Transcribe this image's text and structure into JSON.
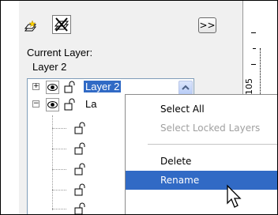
{
  "panel": {
    "current_layer_label": "Current Layer:",
    "current_layer_value": "Layer 2",
    "expand_button": ">>"
  },
  "tree": {
    "rows": [
      {
        "expander": "+",
        "label": "Layer 2",
        "selected": true
      },
      {
        "expander": "−",
        "label": "La",
        "selected": false
      }
    ]
  },
  "ruler": {
    "number": "105"
  },
  "context_menu": {
    "items": [
      {
        "label": "Select All",
        "enabled": true
      },
      {
        "label": "Select Locked Layers",
        "enabled": false
      },
      {
        "label": "Delete",
        "enabled": true
      },
      {
        "label": "Rename",
        "enabled": true,
        "highlighted": true
      }
    ]
  },
  "colors": {
    "selection": "#316ac5",
    "panel_bg": "#f0f0f0"
  },
  "icons": [
    "new-layer-icon",
    "lock-layer-icon",
    "eye-icon",
    "padlock-icon",
    "scroll-up-icon",
    "mouse-pointer-icon"
  ]
}
